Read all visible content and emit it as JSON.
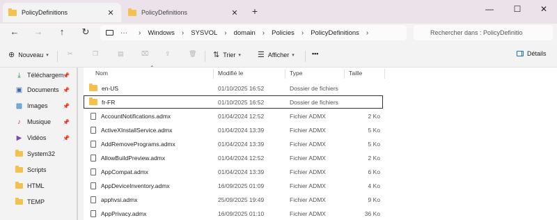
{
  "tabs": [
    {
      "title": "PolicyDefinitions",
      "active": true
    },
    {
      "title": "PolicyDefinitions",
      "active": false
    }
  ],
  "window": {
    "minimize": "—",
    "maximize": "☐",
    "close": "✕"
  },
  "nav": {
    "crumbs": [
      "Windows",
      "SYSVOL",
      "domain",
      "Policies",
      "PolicyDefinitions"
    ],
    "search_placeholder": "Rechercher dans : PolicyDefinitio"
  },
  "commands": {
    "new": "Nouveau",
    "sort": "Trier",
    "view": "Afficher",
    "more": "•••",
    "details": "Détails"
  },
  "sidebar": {
    "items": [
      {
        "label": "Téléchargem",
        "icon": "download-icon",
        "pinned": true
      },
      {
        "label": "Documents",
        "icon": "documents-icon",
        "pinned": true
      },
      {
        "label": "Images",
        "icon": "images-icon",
        "pinned": true
      },
      {
        "label": "Musique",
        "icon": "music-icon",
        "pinned": true
      },
      {
        "label": "Vidéos",
        "icon": "videos-icon",
        "pinned": true
      },
      {
        "label": "System32",
        "icon": "folder-icon",
        "pinned": false
      },
      {
        "label": "Scripts",
        "icon": "folder-icon",
        "pinned": false
      },
      {
        "label": "HTML",
        "icon": "folder-icon",
        "pinned": false
      },
      {
        "label": "TEMP",
        "icon": "folder-icon",
        "pinned": false
      }
    ]
  },
  "columns": {
    "name": "Nom",
    "modified": "Modifié le",
    "type": "Type",
    "size": "Taille"
  },
  "files": [
    {
      "name": "en-US",
      "modified": "01/10/2025 16:52",
      "type": "Dossier de fichiers",
      "size": "",
      "kind": "folder"
    },
    {
      "name": "fr-FR",
      "modified": "01/10/2025 16:52",
      "type": "Dossier de fichiers",
      "size": "",
      "kind": "folder"
    },
    {
      "name": "AccountNotifications.admx",
      "modified": "01/04/2024 12:52",
      "type": "Fichier ADMX",
      "size": "2 Ko",
      "kind": "file"
    },
    {
      "name": "ActiveXInstallService.admx",
      "modified": "01/04/2024 13:39",
      "type": "Fichier ADMX",
      "size": "5 Ko",
      "kind": "file"
    },
    {
      "name": "AddRemovePrograms.admx",
      "modified": "01/04/2024 13:39",
      "type": "Fichier ADMX",
      "size": "5 Ko",
      "kind": "file"
    },
    {
      "name": "AllowBuildPreview.admx",
      "modified": "01/04/2024 12:52",
      "type": "Fichier ADMX",
      "size": "2 Ko",
      "kind": "file"
    },
    {
      "name": "AppCompat.admx",
      "modified": "01/04/2024 13:39",
      "type": "Fichier ADMX",
      "size": "6 Ko",
      "kind": "file"
    },
    {
      "name": "AppDeviceInventory.admx",
      "modified": "16/09/2025 01:09",
      "type": "Fichier ADMX",
      "size": "4 Ko",
      "kind": "file"
    },
    {
      "name": "apphvsi.admx",
      "modified": "25/09/2025 19:49",
      "type": "Fichier ADMX",
      "size": "9 Ko",
      "kind": "file"
    },
    {
      "name": "AppPrivacy.admx",
      "modified": "16/09/2025 01:10",
      "type": "Fichier ADMX",
      "size": "36 Ko",
      "kind": "file"
    }
  ],
  "focused_row": 1,
  "colors": {
    "accent": "#1f6fbf",
    "folder": "#f2c14e",
    "tabbar": "#ebe3e9"
  }
}
